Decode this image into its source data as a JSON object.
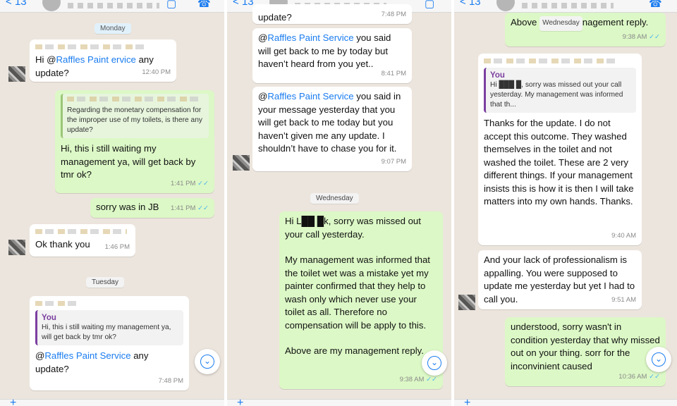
{
  "panel1": {
    "back_count": "13",
    "day_monday": "Monday",
    "m1_prefix": "Hi @",
    "m1_mention": "Raffles Paint",
    "m1_mention2": "ervice",
    "m1_suffix": " any update?",
    "m1_time": "12:40 PM",
    "m2_quote": "Regarding the monetary compensation for the improper use of my toilets, is there any update?",
    "m2_text": "Hi, this i still waiting my management ya, will get back by tmr ok?",
    "m2_time": "1:41 PM",
    "m3_text": "sorry was in JB",
    "m3_time": "1:41 PM",
    "m4_text": "Ok thank you",
    "m4_time": "1:46 PM",
    "day_tuesday": "Tuesday",
    "m5_quote_name": "You",
    "m5_quote": "Hi, this i still waiting my management ya, will get back by tmr ok?",
    "m5_prefix": "@",
    "m5_mention": "Raffles Paint Service",
    "m5_suffix": " any update?",
    "m5_time": "7:48 PM"
  },
  "panel2": {
    "top_fragment": "update?",
    "top_time": "7:48 PM",
    "m1_prefix": "@",
    "m1_mention": "Raffles Paint Service",
    "m1_suffix": " you said will get back to me by today but haven’t heard from you yet..",
    "m1_time": "8:41 PM",
    "m2_prefix": "@",
    "m2_mention": "Raffles Paint Service",
    "m2_suffix": " you said in your message yesterday that you will get back to me today but you haven’t given me any update. I shouldn’t have to chase you for it.",
    "m2_time": "9:07 PM",
    "day_wednesday": "Wednesday",
    "m3_line1": "Hi L██ █k, sorry was missed out your call yesterday.",
    "m3_line2": "My management was informed that the toilet wet was a mistake yet my painter confirmed that they help to wash only which never use your toilet as all. Therefore no compensation will be apply to this.",
    "m3_line3": "Above are my management reply.",
    "m3_time": "9:38 AM"
  },
  "panel3": {
    "top_text_a": "Above ",
    "top_day": "Wednesday",
    "top_text_b": "nagement reply.",
    "top_time": "9:38 AM",
    "m1_quote_name": "You",
    "m1_quote": "Hi ███ █, sorry was missed out your call yesterday. My management was informed that th...",
    "m1_text": "Thanks for the update. I do not accept this outcome. They washed themselves in the toilet and not washed the toilet. These are 2 very different things. If your management insists this is how it is then I will take matters into my own hands. Thanks.",
    "m1_time": "9:40 AM",
    "m2_text": "And your lack of professionalism is appalling. You were supposed to update me yesterday but yet I had to call you.",
    "m2_time": "9:51 AM",
    "m3_text": "understood, sorry wasn't in condition yesterday that why missed out on your thing. sorr for the inconvinient caused",
    "m3_time": "10:36 AM"
  },
  "icons": {
    "ticks": "✓✓",
    "back": "<",
    "video": "▢",
    "call": "☎",
    "scroll": "⌄",
    "plus": "+"
  },
  "colors": {
    "incoming": "#ffffff",
    "outgoing": "#dcf8c6",
    "mention": "#1a7cf0",
    "background": "#ece5dd"
  }
}
